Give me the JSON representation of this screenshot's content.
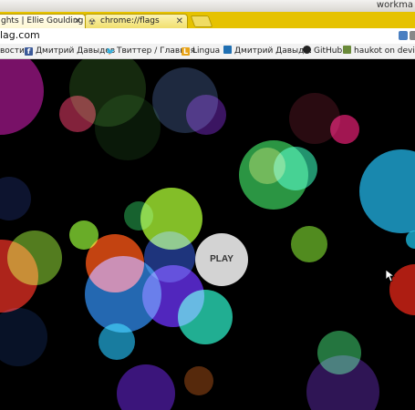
{
  "window": {
    "user": "workma"
  },
  "tabs": [
    {
      "title": "ghts | Ellie Goulding",
      "active": true
    },
    {
      "title": "chrome://flags",
      "icon": "radioactive-icon",
      "active": false
    }
  ],
  "address": {
    "url": "lag.com"
  },
  "bookmarks": [
    {
      "label": "вости",
      "icon": "none"
    },
    {
      "label": "Дмитрий Давыдов",
      "icon": "facebook-icon",
      "color": "#3b5998"
    },
    {
      "label": "Твиттер / Главная",
      "icon": "twitter-icon",
      "color": "#1da1f2"
    },
    {
      "label": "Lingua",
      "icon": "lingua-icon",
      "color": "#e8a317"
    },
    {
      "label": "Дмитрий Давыд...",
      "icon": "trello-icon",
      "color": "#1f6fb2"
    },
    {
      "label": "GitHub",
      "icon": "github-icon",
      "color": "#222222"
    },
    {
      "label": "haukot on devian...",
      "icon": "deviantart-icon",
      "color": "#6a8a3a"
    }
  ],
  "page": {
    "play_label": "PLAY"
  }
}
